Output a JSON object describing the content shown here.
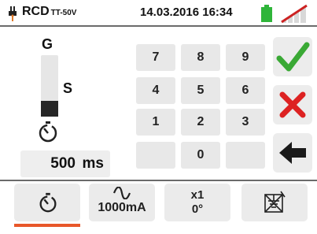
{
  "header": {
    "mode_label": "RCD",
    "mode_sub": "TT-50V",
    "datetime": "14.03.2016 16:34",
    "battery_color": "#2fb53a",
    "signal_color": "#cc2222"
  },
  "left_panel": {
    "top_label": "G",
    "side_label": "S",
    "bar_level_fraction": 0.25,
    "value": "500",
    "unit": "ms"
  },
  "keypad": {
    "keys": [
      "7",
      "8",
      "9",
      "4",
      "5",
      "6",
      "1",
      "2",
      "3",
      "",
      "0",
      ""
    ]
  },
  "actions": {
    "confirm_icon": "check-icon",
    "cancel_icon": "x-icon",
    "back_icon": "arrow-left-icon",
    "confirm_color": "#3aa935",
    "cancel_color": "#dd2222"
  },
  "bottom_tabs": [
    {
      "icon": "timer-icon",
      "label": ""
    },
    {
      "icon": "sine-wave-icon",
      "label": "1000mA"
    },
    {
      "icon": "",
      "label_top": "x1",
      "label_bottom": "0°"
    },
    {
      "icon": "no-ground-icon",
      "label": ""
    }
  ],
  "accent_color": "#e8572a"
}
